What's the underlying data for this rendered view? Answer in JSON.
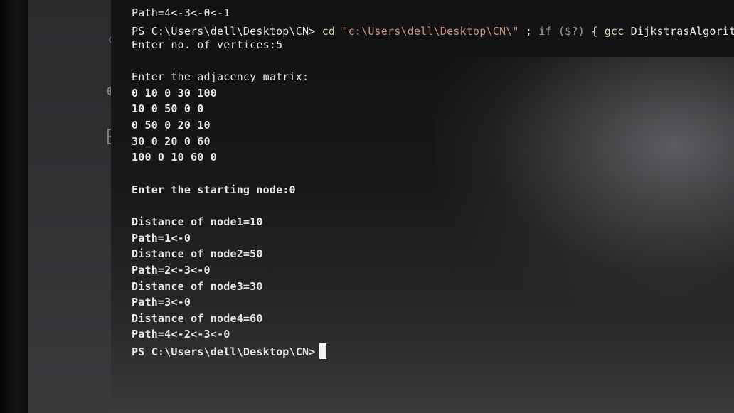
{
  "activity_bar": {
    "icons": [
      "source-control-icon",
      "run-debug-icon",
      "extensions-icon"
    ]
  },
  "terminal": {
    "line_path_prev": "Path=4<-3<-0<-1",
    "line_cmd": {
      "prompt": "PS C:\\Users\\dell\\Desktop\\CN>",
      "cmd": "cd",
      "path_str": "\"c:\\Users\\dell\\Desktop\\CN\\\"",
      "sep": ";",
      "if_kw": "if",
      "cond": "($?)",
      "brace": "{",
      "gcc": "gcc",
      "file": "DijkstrasAlgorithm.c"
    },
    "vertices_prompt": "Enter no. of vertices:5",
    "adjacency_prompt": "Enter the adjacency matrix:",
    "matrix_rows": [
      "0 10 0 30 100",
      "10 0 50 0 0",
      "0 50 0 20 10",
      "30 0 20 0 60",
      "100 0 10 60 0"
    ],
    "start_prompt": "Enter the starting node:0",
    "results": [
      "Distance of node1=10",
      "Path=1<-0",
      "Distance of node2=50",
      "Path=2<-3<-0",
      "Distance of node3=30",
      "Path=3<-0",
      "Distance of node4=60",
      "Path=4<-2<-3<-0"
    ],
    "final_prompt": "PS C:\\Users\\dell\\Desktop\\CN>"
  }
}
